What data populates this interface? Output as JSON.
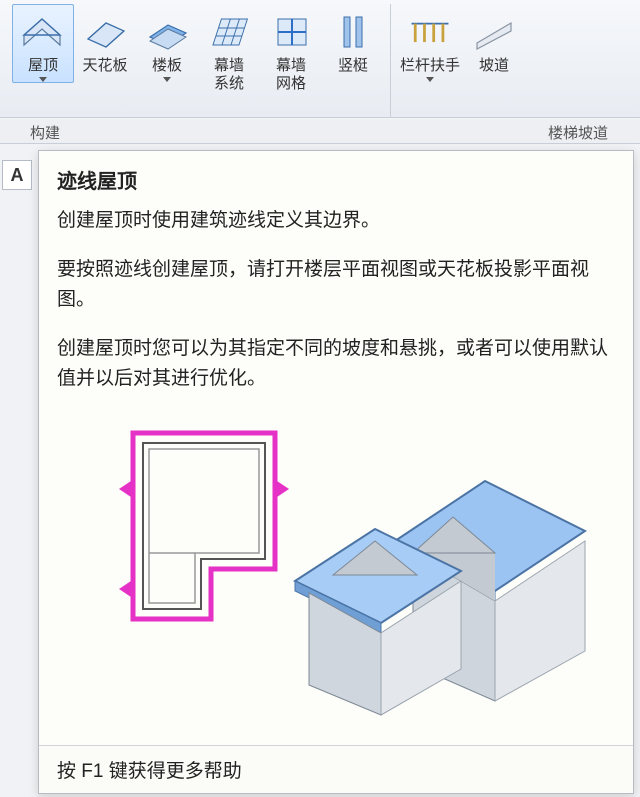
{
  "ribbon": {
    "groups": [
      {
        "buttons": [
          {
            "id": "roof",
            "label": "屋顶",
            "hasDropdown": true,
            "selected": true
          },
          {
            "id": "ceiling",
            "label": "天花板",
            "hasDropdown": false
          },
          {
            "id": "floor",
            "label": "楼板",
            "hasDropdown": true
          },
          {
            "id": "curtain-system",
            "label": "幕墙\n系统",
            "hasDropdown": false
          },
          {
            "id": "curtain-grid",
            "label": "幕墙\n网格",
            "hasDropdown": false
          },
          {
            "id": "mullion",
            "label": "竖梃",
            "hasDropdown": false
          }
        ]
      },
      {
        "buttons": [
          {
            "id": "railing",
            "label": "栏杆扶手",
            "hasDropdown": true
          },
          {
            "id": "ramp",
            "label": "坡道",
            "hasDropdown": false
          }
        ]
      }
    ],
    "panel_left": "构建",
    "panel_right": "楼梯坡道"
  },
  "sidebar": {
    "a_label": "A"
  },
  "tooltip": {
    "title": "迹线屋顶",
    "p1": "创建屋顶时使用建筑迹线定义其边界。",
    "p2": "要按照迹线创建屋顶，请打开楼层平面视图或天花板投影平面视图。",
    "p3": "创建屋顶时您可以为其指定不同的坡度和悬挑，或者可以使用默认值并以后对其进行优化。",
    "footer": "按 F1 键获得更多帮助"
  },
  "colors": {
    "accent_blue": "#88b8ea",
    "roof_blue": "#93bdef",
    "wall_gray": "#d6dade",
    "plan_magenta": "#e531c6"
  }
}
